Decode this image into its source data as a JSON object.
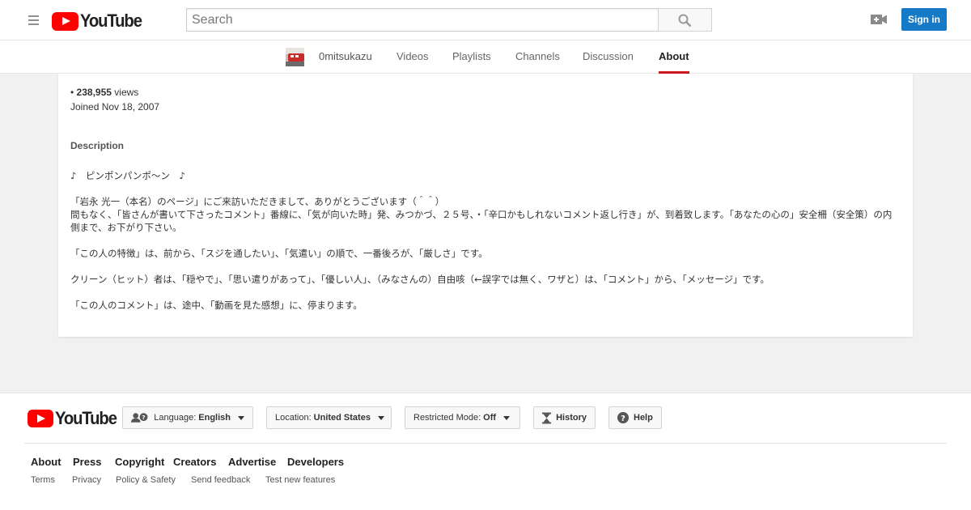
{
  "header": {
    "logo_text": "YouTube",
    "search_placeholder": "Search",
    "search_value": "",
    "signin_label": "Sign in",
    "accent_color": "#ff0000",
    "signin_color": "#167ac6"
  },
  "channel_nav": {
    "channel_name": "0mitsukazu",
    "tabs": [
      "Videos",
      "Playlists",
      "Channels",
      "Discussion",
      "About"
    ],
    "active_tab": "About"
  },
  "about": {
    "views_prefix": "•",
    "views_count": "238,955",
    "views_suffix": "views",
    "joined": "Joined Nov 18, 2007",
    "description_heading": "Description",
    "description_paragraphs": [
      "♪　ピンポンパンポ～ン　♪",
      "「岩永 光一（本名）のページ」にご来訪いただきまして、ありがとうございます（＾＾）",
      "間もなく、「皆さんが書いて下さったコメント」番線に、「気が向いた時」発、みつかづ、２５号、・「辛口かもしれないコメント返し行き」が、到着致します。「あなたの心の」安全柵（安全策）の内側まで、お下がり下さい。",
      "「この人の特徴」は、前から、「スジを通したい」、「気遣い」の順で、一番後ろが、「厳しさ」です。",
      "クリーン（ヒット）者は、「穏やで」、「思い遣りがあって」、「優しい人」、（みなさんの）自由咳（←誤字では無く、ワザと）は、「コメント」から、「メッセージ」です。",
      "「この人のコメント」は、途中、「動画を見た感想」に、停まります。"
    ]
  },
  "footer": {
    "logo_text": "YouTube",
    "language_label": "Language:",
    "language_value": "English",
    "location_label": "Location:",
    "location_value": "United States",
    "restricted_label": "Restricted Mode:",
    "restricted_value": "Off",
    "history_label": "History",
    "help_label": "Help",
    "primary_links": [
      "About",
      "Press",
      "Copyright",
      "Creators",
      "Advertise",
      "Developers"
    ],
    "secondary_links": [
      "Terms",
      "Privacy",
      "Policy & Safety",
      "Send feedback",
      "Test new features"
    ]
  }
}
